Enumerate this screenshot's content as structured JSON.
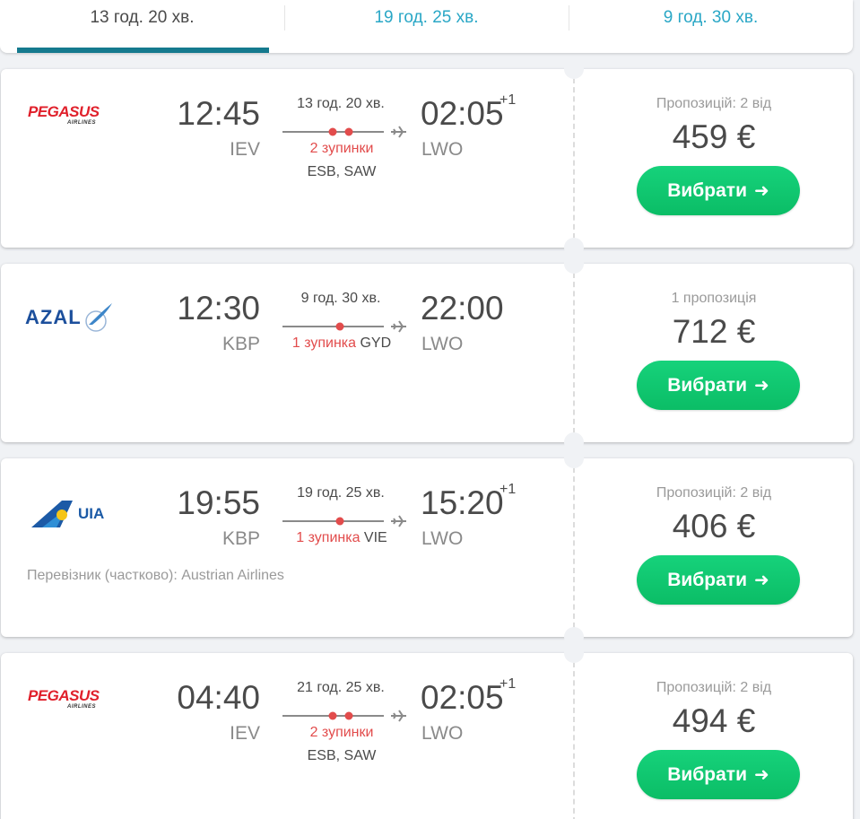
{
  "tabs": [
    {
      "label": "13 год. 20 хв.",
      "active": true
    },
    {
      "label": "19 год. 25 хв.",
      "active": false
    },
    {
      "label": "9 год. 30 хв.",
      "active": false
    }
  ],
  "colors": {
    "accent": "#157a8e",
    "link": "#2aa7c6",
    "button": "#0bbd66",
    "stop": "#e24c4c"
  },
  "flights": [
    {
      "airline": "Pegasus Airlines",
      "logo_text": "PEGASUS",
      "logo_sub": "AIRLINES",
      "dep_time": "12:45",
      "dep_code": "IEV",
      "arr_time": "02:05",
      "arr_plus": "+1",
      "arr_code": "LWO",
      "duration": "13 год. 20 хв.",
      "stops_red": "2 зупинки",
      "stops_place": "",
      "via": "ESB, SAW",
      "carrier": "",
      "offers": "Пропозицій: 2 від",
      "price": "459 €",
      "button": "Вибрати",
      "stop_count": 2
    },
    {
      "airline": "AZAL",
      "logo_text": "AZAL",
      "logo_sub": "",
      "dep_time": "12:30",
      "dep_code": "KBP",
      "arr_time": "22:00",
      "arr_plus": "",
      "arr_code": "LWO",
      "duration": "9 год. 30 хв.",
      "stops_red": "1 зупинка",
      "stops_place": "GYD",
      "via": "",
      "carrier": "",
      "offers": "1 пропозиція",
      "price": "712 €",
      "button": "Вибрати",
      "stop_count": 1
    },
    {
      "airline": "UIA",
      "logo_text": "UIA",
      "logo_sub": "",
      "dep_time": "19:55",
      "dep_code": "KBP",
      "arr_time": "15:20",
      "arr_plus": "+1",
      "arr_code": "LWO",
      "duration": "19 год. 25 хв.",
      "stops_red": "1 зупинка",
      "stops_place": "VIE",
      "via": "",
      "carrier": "Перевізник (частково): Austrian Airlines",
      "offers": "Пропозицій: 2 від",
      "price": "406 €",
      "button": "Вибрати",
      "stop_count": 1
    },
    {
      "airline": "Pegasus Airlines",
      "logo_text": "PEGASUS",
      "logo_sub": "AIRLINES",
      "dep_time": "04:40",
      "dep_code": "IEV",
      "arr_time": "02:05",
      "arr_plus": "+1",
      "arr_code": "LWO",
      "duration": "21 год. 25 хв.",
      "stops_red": "2 зупинки",
      "stops_place": "",
      "via": "ESB, SAW",
      "carrier": "",
      "offers": "Пропозицій: 2 від",
      "price": "494 €",
      "button": "Вибрати",
      "stop_count": 2
    }
  ]
}
